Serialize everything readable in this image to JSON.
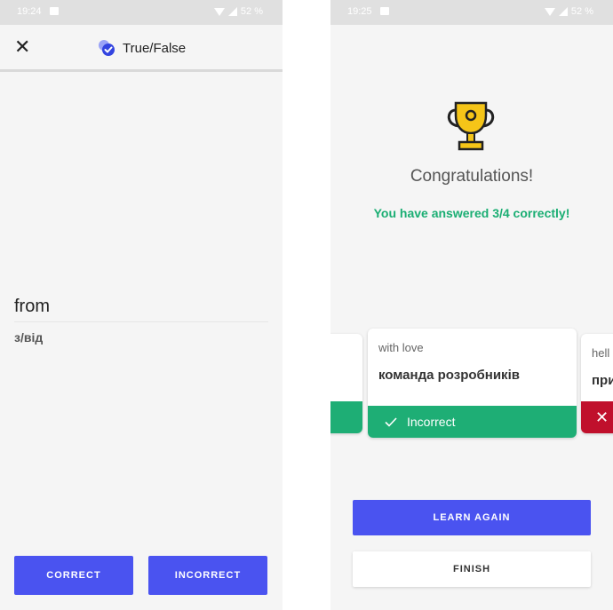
{
  "left_screen": {
    "status_bar": {
      "time": "19:24",
      "battery": "52 %"
    },
    "app_bar": {
      "title": "True/False"
    },
    "word": "from",
    "translation": "з/від",
    "buttons": {
      "correct": "CORRECT",
      "incorrect": "INCORRECT"
    }
  },
  "right_screen": {
    "status_bar": {
      "time": "19:25",
      "battery": "52 %"
    },
    "congrats": "Congratulations!",
    "score_text": "You have answered 3/4 correctly!",
    "cards": [
      {
        "word": "with love",
        "translation": "команда розробників",
        "result": "Incorrect",
        "result_icon": "check-icon",
        "result_color": "#1eae75"
      },
      {
        "word": "hell",
        "translation": "при",
        "result_icon": "close-icon",
        "result_color": "#c0102c"
      }
    ],
    "buttons": {
      "learn_again": "LEARN AGAIN",
      "finish": "FINISH"
    }
  },
  "colors": {
    "primary": "#4a53f0",
    "success": "#1eae75",
    "error": "#c0102c",
    "trophy": "#f5c518"
  }
}
